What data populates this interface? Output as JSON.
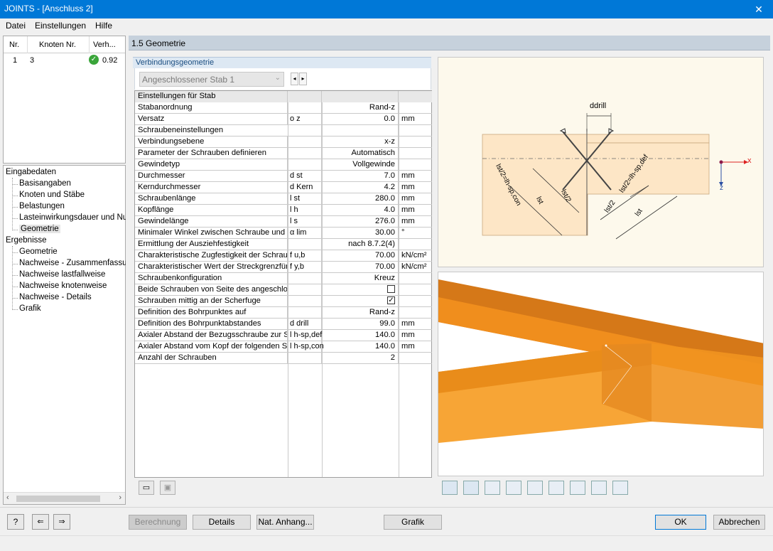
{
  "window": {
    "title": "JOINTS - [Anschluss 2]"
  },
  "menu": {
    "items": [
      "Datei",
      "Einstellungen",
      "Hilfe"
    ]
  },
  "nav_table": {
    "headers": [
      "Nr.",
      "Knoten Nr.",
      "Verh..."
    ],
    "rows": [
      {
        "nr": "1",
        "knoten": "3",
        "verh": "0.92"
      }
    ]
  },
  "tree": {
    "group1": "Eingabedaten",
    "group1_items": [
      "Basisangaben",
      "Knoten und Stäbe",
      "Belastungen",
      "Lasteinwirkungsdauer und Nutz",
      "Geometrie"
    ],
    "group2": "Ergebnisse",
    "group2_items": [
      "Geometrie",
      "Nachweise - Zusammenfassung",
      "Nachweise lastfallweise",
      "Nachweise knotenweise",
      "Nachweise - Details",
      "Grafik"
    ]
  },
  "section": {
    "title": "1.5 Geometrie"
  },
  "group": {
    "title": "Verbindungsgeometrie",
    "combo_value": "Angeschlossener Stab 1"
  },
  "grid": [
    {
      "type": "header",
      "label": "Einstellungen für Stab"
    },
    {
      "label": "Stabanordnung",
      "sym": "",
      "val": "Rand-z",
      "unit": ""
    },
    {
      "label": "Versatz",
      "sym": "o z",
      "val": "0.0",
      "unit": "mm"
    },
    {
      "type": "header2",
      "label": "Schraubeneinstellungen"
    },
    {
      "label": "Verbindungsebene",
      "sym": "",
      "val": "x-z",
      "unit": ""
    },
    {
      "label": "Parameter der Schrauben definieren",
      "sym": "",
      "val": "Automatisch",
      "unit": ""
    },
    {
      "label": "Gewindetyp",
      "sym": "",
      "val": "Vollgewinde",
      "unit": ""
    },
    {
      "label": "Durchmesser",
      "sym": "d st",
      "val": "7.0",
      "unit": "mm"
    },
    {
      "label": "Kerndurchmesser",
      "sym": "d Kern",
      "val": "4.2",
      "unit": "mm"
    },
    {
      "label": "Schraubenlänge",
      "sym": "l st",
      "val": "280.0",
      "unit": "mm"
    },
    {
      "label": "Kopflänge",
      "sym": "l h",
      "val": "4.0",
      "unit": "mm"
    },
    {
      "label": "Gewindelänge",
      "sym": "l s",
      "val": "276.0",
      "unit": "mm"
    },
    {
      "label": "Minimaler Winkel zwischen Schraube und F",
      "sym": "α lim",
      "val": "30.00",
      "unit": "°"
    },
    {
      "label": "Ermittlung der Ausziehfestigkeit",
      "sym": "",
      "val": "nach 8.7.2(4)",
      "unit": ""
    },
    {
      "label": "Charakteristische Zugfestigkeit der Schraub",
      "sym": "f u,b",
      "val": "70.00",
      "unit": "kN/cm²"
    },
    {
      "label": "Charakteristischer Wert der Streckgrenzfür c",
      "sym": "f y,b",
      "val": "70.00",
      "unit": "kN/cm²"
    },
    {
      "label": "Schraubenkonfiguration",
      "sym": "",
      "val": "Kreuz",
      "unit": ""
    },
    {
      "label": "Beide Schrauben von Seite des angeschlos",
      "sym": "",
      "val": "",
      "unit": "",
      "check": false
    },
    {
      "label": "Schrauben mittig an der Scherfuge",
      "sym": "",
      "val": "",
      "unit": "",
      "check": true
    },
    {
      "label": "Definition des Bohrpunktes auf",
      "sym": "",
      "val": "Rand-z",
      "unit": ""
    },
    {
      "label": "Definition des Bohrpunktabstandes",
      "sym": "d drill",
      "val": "99.0",
      "unit": "mm"
    },
    {
      "label": "Axialer Abstand der Bezugsschraube zur Sc",
      "sym": "l h-sp,def",
      "val": "140.0",
      "unit": "mm"
    },
    {
      "label": "Axialer Abstand vom Kopf der folgenden Scl",
      "sym": "l h-sp,con",
      "val": "140.0",
      "unit": "mm"
    },
    {
      "label": "Anzahl der Schrauben",
      "sym": "",
      "val": "2",
      "unit": ""
    }
  ],
  "diagram": {
    "labels": {
      "ddrill": "ddrill",
      "x": "x",
      "z": "z",
      "lst_hspcon": "lst/2=lh-sp,con",
      "lst_hspdef": "lst/2=lh-sp,def",
      "lst_half1": "lst/2",
      "lst_half2": "lst/2",
      "lst1": "lst",
      "lst2": "lst"
    }
  },
  "buttons": {
    "berechnung": "Berechnung",
    "details": "Details",
    "nat_anhang": "Nat. Anhang...",
    "grafik": "Grafik",
    "ok": "OK",
    "abbrechen": "Abbrechen"
  },
  "colors": {
    "titlebar": "#0078d7",
    "wood": "#fde6c6",
    "beam": "#f5921e",
    "accent": "#1a4d80"
  }
}
